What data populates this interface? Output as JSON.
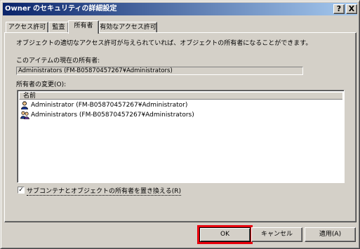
{
  "window": {
    "title": "Owner のセキュリティの詳細設定",
    "help_button": "?",
    "close_button": "X"
  },
  "tabs": [
    {
      "label": "アクセス許可",
      "active": false
    },
    {
      "label": "監査",
      "active": false
    },
    {
      "label": "所有者",
      "active": true
    },
    {
      "label": "有効なアクセス許可",
      "active": false
    }
  ],
  "panel": {
    "description": "オブジェクトの適切なアクセス許可が与えられていれば、オブジェクトの所有者になることができます。",
    "current_owner_label": "このアイテムの現在の所有者:",
    "current_owner_value": "Administrators (FM-B05870457267¥Administrators)",
    "change_owner_label": "所有者の変更(O):",
    "list": {
      "column_header": "名前",
      "items": [
        {
          "label": "Administrator (FM-B05870457267¥Administrator)",
          "icon": "user-icon"
        },
        {
          "label": "Administrators (FM-B05870457267¥Administrators)",
          "icon": "group-icon"
        }
      ]
    },
    "replace_owner_checkbox": {
      "label": "サブコンテナとオブジェクトの所有者を置き換える(R)",
      "checked": true,
      "mark": "✓"
    }
  },
  "buttons": {
    "ok": "OK",
    "cancel": "キャンセル",
    "apply": "適用(A)"
  },
  "colors": {
    "titlebar_start": "#0a246a",
    "titlebar_end": "#a6caf0",
    "face": "#d4d0c8",
    "highlight_box": "#e8000d"
  }
}
